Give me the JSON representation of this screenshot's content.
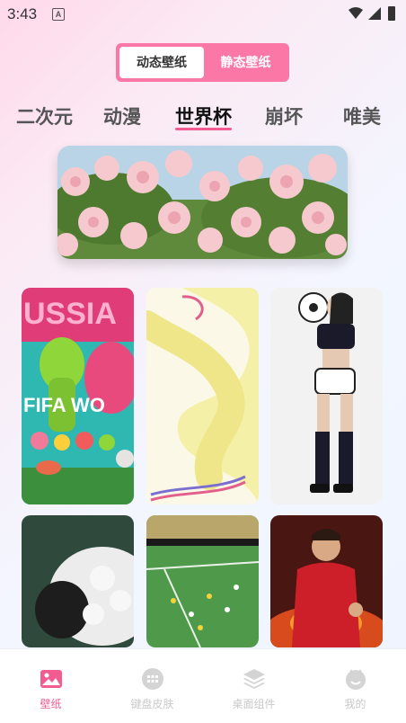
{
  "status": {
    "time": "3:43",
    "indicator": "A"
  },
  "toggle": {
    "active_label": "动态壁纸",
    "inactive_label": "静态壁纸"
  },
  "categories": [
    "二次元",
    "动漫",
    "世界杯",
    "崩坏",
    "唯美"
  ],
  "active_category": "世界杯",
  "grid_texts": {
    "card1_top": "USSIA",
    "card1_mid": "FIFA WO"
  },
  "tabs": [
    {
      "label": "壁纸",
      "icon": "image-icon"
    },
    {
      "label": "键盘皮肤",
      "icon": "keyboard-icon"
    },
    {
      "label": "桌面组件",
      "icon": "layers-icon"
    },
    {
      "label": "我的",
      "icon": "smiley-icon"
    }
  ],
  "colors": {
    "accent": "#f35c91",
    "toggle_bg": "#fb78a6",
    "tab_inactive": "#c9c9c9"
  }
}
